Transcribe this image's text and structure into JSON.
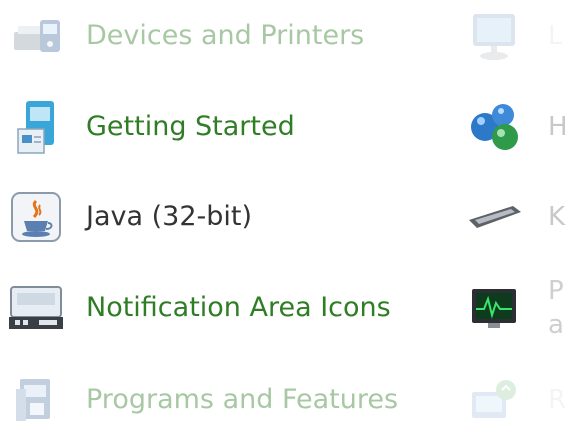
{
  "items_left": [
    {
      "label": "Devices and Printers",
      "icon": "devices-printers-icon"
    },
    {
      "label": "Getting Started",
      "icon": "getting-started-icon"
    },
    {
      "label": "Java (32-bit)",
      "icon": "java-icon"
    },
    {
      "label": "Notification Area Icons",
      "icon": "notification-area-icon"
    },
    {
      "label": "Programs and Features",
      "icon": "programs-features-icon"
    }
  ],
  "items_right": [
    {
      "label": "L",
      "icon": "display-icon"
    },
    {
      "label": "H",
      "icon": "homegroup-icon"
    },
    {
      "label": "K",
      "icon": "keyboard-icon"
    },
    {
      "label_line1": "P",
      "label_line2": "a",
      "icon": "performance-icon"
    },
    {
      "label": "R",
      "icon": "recovery-icon"
    }
  ],
  "colors": {
    "link_green": "#2f7d25",
    "text_dark": "#333333"
  }
}
